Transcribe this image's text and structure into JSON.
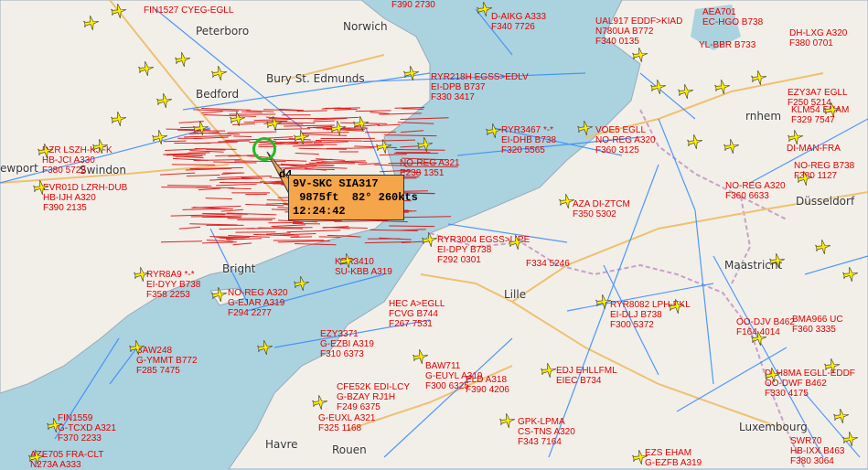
{
  "map": {
    "cities": [
      {
        "id": "peterboro",
        "name": "Peterboro"
      },
      {
        "id": "norwich",
        "name": "Norwich"
      },
      {
        "id": "bedford",
        "name": "Bedford"
      },
      {
        "id": "bury",
        "name": "Bury St. Edmunds"
      },
      {
        "id": "newport",
        "name": "ewport"
      },
      {
        "id": "swindon",
        "name": "Swindon"
      },
      {
        "id": "lille",
        "name": "Lille"
      },
      {
        "id": "dusseldorf",
        "name": "Düsseldorf"
      },
      {
        "id": "maastricht",
        "name": "Maastricht"
      },
      {
        "id": "luxembourg",
        "name": "Luxembourg"
      },
      {
        "id": "havre",
        "name": "Havre"
      },
      {
        "id": "rouen",
        "name": "Rouen"
      },
      {
        "id": "bright",
        "name": "Bright"
      },
      {
        "id": "arnhem",
        "name": "rnhem"
      }
    ],
    "aircraft": [
      {
        "id": "a1",
        "lines": [
          "FIN1527 CYEG-EGLL"
        ]
      },
      {
        "id": "a2",
        "lines": [
          "F390 2730"
        ]
      },
      {
        "id": "a3",
        "lines": [
          "D-AIKG A333",
          "F340 7726"
        ]
      },
      {
        "id": "a4",
        "lines": [
          "UAL917 EDDF>KIAD",
          "N780UA B772",
          "F340 0135"
        ]
      },
      {
        "id": "a5",
        "lines": [
          "AEA701",
          "EC-HGO B738"
        ]
      },
      {
        "id": "a6",
        "lines": [
          "DH-LXG A320",
          "F380 0701"
        ]
      },
      {
        "id": "a7",
        "lines": [
          "YL-BBR B733"
        ]
      },
      {
        "id": "a8",
        "lines": [
          "RYR218H EGSS>EDLV",
          "EI-DPB B737",
          "F330 3417"
        ]
      },
      {
        "id": "a9",
        "lines": [
          "RYR3467 *-*",
          "EI-DHB B738",
          "F320 5565"
        ]
      },
      {
        "id": "a10",
        "lines": [
          "NO-REG A321",
          "E238 1351"
        ]
      },
      {
        "id": "a11",
        "lines": [
          "VOE5 EGLL",
          "NO-REG A320",
          "F360 3125"
        ]
      },
      {
        "id": "a12",
        "lines": [
          "DI-MAN-FRA"
        ]
      },
      {
        "id": "a13",
        "lines": [
          "NO-REG A320",
          "F360 6633"
        ]
      },
      {
        "id": "a14",
        "lines": [
          "RYR3004 EGSS>LIPE",
          "EI-DPY B738",
          "F292 0301"
        ]
      },
      {
        "id": "a15",
        "lines": [
          "F334 5246"
        ]
      },
      {
        "id": "a16",
        "lines": [
          "KBR3410",
          "SU-KBB A319"
        ]
      },
      {
        "id": "a17",
        "lines": [
          "RYR8A9 *-*",
          "EI-DYY B738",
          "F358 2253"
        ]
      },
      {
        "id": "a18",
        "lines": [
          "NO-REG A320",
          "G-EJAR A319",
          "F294 2277"
        ]
      },
      {
        "id": "a19",
        "lines": [
          "HEC A>EGLL",
          "FCVG B744",
          "F267 7531"
        ]
      },
      {
        "id": "a20",
        "lines": [
          "EZY3371",
          "G-EZBI A319",
          "F310 6373"
        ]
      },
      {
        "id": "a21",
        "lines": [
          "BAW248",
          "G-YMMT B772",
          "F285 7475"
        ]
      },
      {
        "id": "a22",
        "lines": [
          "BAW711",
          "G-EUYL A319",
          "F300 6325"
        ]
      },
      {
        "id": "a23",
        "lines": [
          "EDJ EHLLFML",
          "EIEC B734"
        ]
      },
      {
        "id": "a24",
        "lines": [
          "CFE52K EDI-LCY",
          "G-BZAY RJ1H",
          "F249 6375"
        ]
      },
      {
        "id": "a25",
        "lines": [
          "G-EUXL A321",
          "F325 1168"
        ]
      },
      {
        "id": "a26",
        "lines": [
          "GPK-LPMA",
          "CS-TNS A320",
          "F343 7164"
        ]
      },
      {
        "id": "a27",
        "lines": [
          "FIN1559",
          "G-TCXD A321",
          "F370 2233"
        ]
      },
      {
        "id": "a28",
        "lines": [
          "AZE705 FRA-CLT",
          "N273A A333"
        ]
      },
      {
        "id": "a29",
        "lines": [
          "EZS EHAM",
          "G-EZFB A319"
        ]
      },
      {
        "id": "a30",
        "lines": [
          "SWR70",
          "HB-IXX B463",
          "F380 3064"
        ]
      },
      {
        "id": "a31",
        "lines": [
          "DZR LSZH-KJFK",
          "HB-JCI A330",
          "F380 5722"
        ]
      },
      {
        "id": "a32",
        "lines": [
          "EVR01D LZRH-DUB",
          "HB-IJH A320",
          "F390 2135"
        ]
      },
      {
        "id": "a33",
        "lines": [
          "RYR8082 LPH-EKL",
          "EI-DLJ B738",
          "F300 5372"
        ]
      },
      {
        "id": "a34",
        "lines": [
          "OO-DJV B462",
          "F164 4014"
        ]
      },
      {
        "id": "a35",
        "lines": [
          "BMA966 UC",
          "F360 3335"
        ]
      },
      {
        "id": "a36",
        "lines": [
          "DLH8MA EGLL-EDDF",
          "OO-DWF B462",
          "F330 4175"
        ]
      },
      {
        "id": "a37",
        "lines": [
          "EZY3A7 EGLL",
          "F250 5214"
        ]
      },
      {
        "id": "a38",
        "lines": [
          "KLM54 EHAM",
          "F329 7547"
        ]
      },
      {
        "id": "a39",
        "lines": [
          "NO-REG B738",
          "F380 1127"
        ]
      },
      {
        "id": "a40",
        "lines": [
          "ELD A318",
          "F390 4206"
        ]
      },
      {
        "id": "a41",
        "lines": [
          "AZA DI-ZTCM",
          "F350 5302"
        ]
      }
    ],
    "tooltip": {
      "prefix": "d4",
      "line1": "9V-SKC SIA317",
      "line2": " 9875ft  82° 260kts",
      "line3": "12:24:42"
    },
    "colors": {
      "sea": "#aad3df",
      "land": "#f2efe9",
      "label": "#e00000",
      "plane": "#ffee00",
      "track": "#3388ff",
      "tooltip": "#f5a54a",
      "selection": "#22bb22"
    }
  }
}
